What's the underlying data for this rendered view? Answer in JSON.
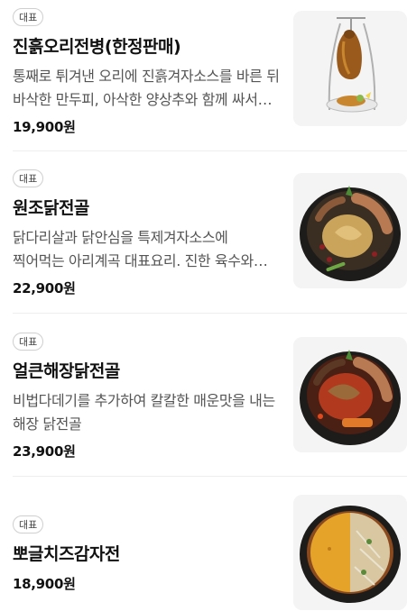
{
  "menu": {
    "items": [
      {
        "badge": "대표",
        "name": "진흙오리전병(한정판매)",
        "description": "통째로 튀겨낸 오리에 진흙겨자소스를 바른 뒤 바삭한 만두피, 아삭한 양상추와 함께 싸서 즐기는 메뉴",
        "price": "19,900원",
        "image_icon": "roast-duck-photo"
      },
      {
        "badge": "대표",
        "name": "원조닭전골",
        "description": "닭다리살과 닭안심을 특제겨자소스에 찍어먹는 아리계곡 대표요리. 진한 육수와 함께",
        "price": "22,900원",
        "image_icon": "chicken-hotpot-photo"
      },
      {
        "badge": "대표",
        "name": "얼큰해장닭전골",
        "description": "비법다데기를 추가하여 칼칼한 매운맛을 내는 해장 닭전골",
        "price": "23,900원",
        "image_icon": "spicy-chicken-hotpot-photo"
      },
      {
        "badge": "대표",
        "name": "뽀글치즈감자전",
        "description": "",
        "price": "18,900원",
        "image_icon": "cheese-potato-pancake-photo"
      }
    ]
  }
}
